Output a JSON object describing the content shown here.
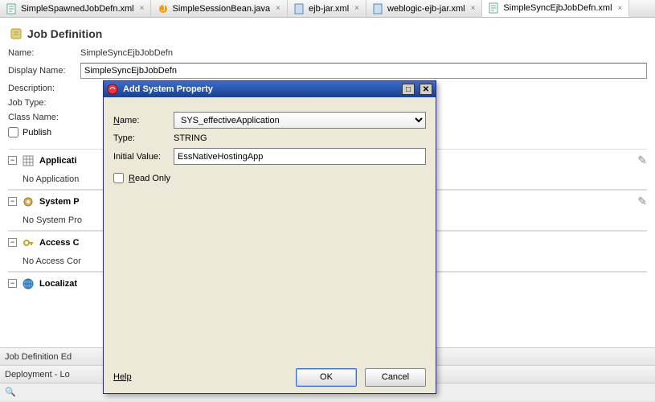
{
  "tabs": [
    {
      "label": "SimpleSpawnedJobDefn.xml"
    },
    {
      "label": "SimpleSessionBean.java"
    },
    {
      "label": "ejb-jar.xml"
    },
    {
      "label": "weblogic-ejb-jar.xml"
    },
    {
      "label": "SimpleSyncEjbJobDefn.xml"
    }
  ],
  "page": {
    "title": "Job Definition",
    "name_label": "Name:",
    "name_value": "SimpleSyncEjbJobDefn",
    "display_label": "Display Name:",
    "display_value": "SimpleSyncEjbJobDefn",
    "desc_label": "Description:",
    "jobtype_label": "Job Type:",
    "class_label": "Class Name:",
    "publish_label": "Publish"
  },
  "sections": {
    "app_params_title": "Applicati",
    "app_params_body": "No Application",
    "sys_props_title": "System P",
    "sys_props_body": "No System Pro",
    "access_title": "Access  C",
    "access_body": "No Access Cor",
    "loc_title": "Localizat"
  },
  "footer": {
    "tab": "Job Definition Ed"
  },
  "status": {
    "text": "Deployment - Lo"
  },
  "search": {
    "placeholder": ""
  },
  "dialog": {
    "title": "Add System Property",
    "name_label": "Name:",
    "name_value": "SYS_effectiveApplication",
    "type_label": "Type:",
    "type_value": "STRING",
    "init_label": "Initial Value:",
    "init_value": "EssNativeHostingApp",
    "readonly_label": "Read Only",
    "help": "Help",
    "ok": "OK",
    "cancel": "Cancel"
  }
}
